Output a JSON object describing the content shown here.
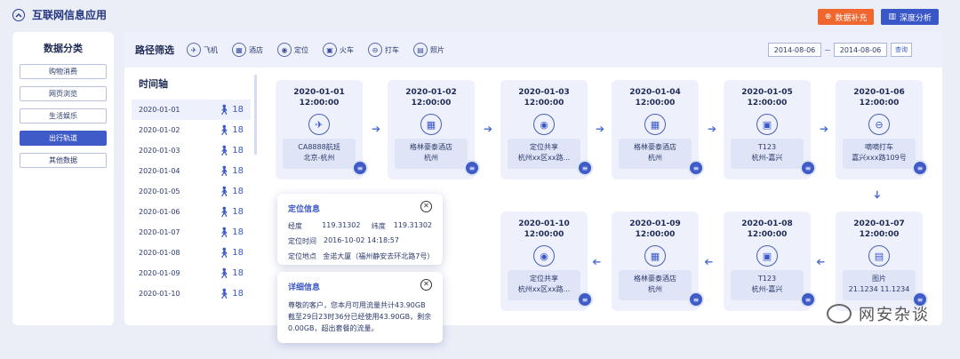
{
  "app": {
    "title": "互联网信息应用"
  },
  "header_actions": {
    "data_fill": "数据补充",
    "deep_analysis": "深度分析"
  },
  "sidebar": {
    "title": "数据分类",
    "items": [
      {
        "label": "购物消费"
      },
      {
        "label": "网页浏览"
      },
      {
        "label": "生活娱乐"
      },
      {
        "label": "出行轨道"
      },
      {
        "label": "其他数据"
      }
    ]
  },
  "filter": {
    "title": "路径筛选",
    "items": [
      {
        "label": "飞机",
        "icon": "plane-icon"
      },
      {
        "label": "酒店",
        "icon": "hotel-icon"
      },
      {
        "label": "定位",
        "icon": "location-icon"
      },
      {
        "label": "火车",
        "icon": "train-icon"
      },
      {
        "label": "打车",
        "icon": "taxi-icon"
      },
      {
        "label": "照片",
        "icon": "photo-icon"
      }
    ],
    "date_from": "2014-08-06",
    "date_to": "2014-08-06",
    "query": "查询"
  },
  "timeline": {
    "title": "时间轴",
    "rows": [
      {
        "date": "2020-01-01",
        "count": "18"
      },
      {
        "date": "2020-01-02",
        "count": "18"
      },
      {
        "date": "2020-01-03",
        "count": "18"
      },
      {
        "date": "2020-01-04",
        "count": "18"
      },
      {
        "date": "2020-01-05",
        "count": "18"
      },
      {
        "date": "2020-01-06",
        "count": "18"
      },
      {
        "date": "2020-01-07",
        "count": "18"
      },
      {
        "date": "2020-01-08",
        "count": "18"
      },
      {
        "date": "2020-01-09",
        "count": "18"
      },
      {
        "date": "2020-01-10",
        "count": "18"
      }
    ]
  },
  "cards": [
    {
      "date": "2020-01-01",
      "time": "12:00:00",
      "icon": "plane-icon",
      "line1": "CA8888航班",
      "line2": "北京-杭州"
    },
    {
      "date": "2020-01-02",
      "time": "12:00:00",
      "icon": "hotel-icon",
      "line1": "格林豪泰酒店",
      "line2": "杭州"
    },
    {
      "date": "2020-01-03",
      "time": "12:00:00",
      "icon": "location-icon",
      "line1": "定位共享",
      "line2": "杭州xx区xx路..."
    },
    {
      "date": "2020-01-04",
      "time": "12:00:00",
      "icon": "hotel-icon",
      "line1": "格林豪泰酒店",
      "line2": "杭州"
    },
    {
      "date": "2020-01-05",
      "time": "12:00:00",
      "icon": "train-icon",
      "line1": "T123",
      "line2": "杭州-嘉兴"
    },
    {
      "date": "2020-01-06",
      "time": "12:00:00",
      "icon": "taxi-icon",
      "line1": "嘀嘀打车",
      "line2": "嘉兴xxx路109号"
    },
    {
      "date": "2020-01-07",
      "time": "12:00:00",
      "icon": "photo-icon",
      "line1": "图片",
      "line2": "21.1234    11.1234"
    },
    {
      "date": "2020-01-08",
      "time": "12:00:00",
      "icon": "train-icon",
      "line1": "T123",
      "line2": "杭州-嘉兴"
    },
    {
      "date": "2020-01-09",
      "time": "12:00:00",
      "icon": "hotel-icon",
      "line1": "格林豪泰酒店",
      "line2": "杭州"
    },
    {
      "date": "2020-01-10",
      "time": "12:00:00",
      "icon": "location-icon",
      "line1": "定位共享",
      "line2": "杭州xx区xx路..."
    }
  ],
  "popup_location": {
    "title": "定位信息",
    "lng_label": "经度",
    "lng": "119.31302",
    "lat_label": "纬度",
    "lat": "119.31302",
    "time_label": "定位时间",
    "time": "2016-10-02  14:18:57",
    "place_label": "定位地点",
    "place": "金诺大厦（福州静安去环北路7号）"
  },
  "popup_detail": {
    "title": "详细信息",
    "text": "尊敬的客户，您本月可用流量共计43.90GB截至29日23时36分已经使用43.90GB，剩余0.00GB，超出套餐的流量。"
  },
  "watermark": {
    "text": "网安杂谈"
  }
}
